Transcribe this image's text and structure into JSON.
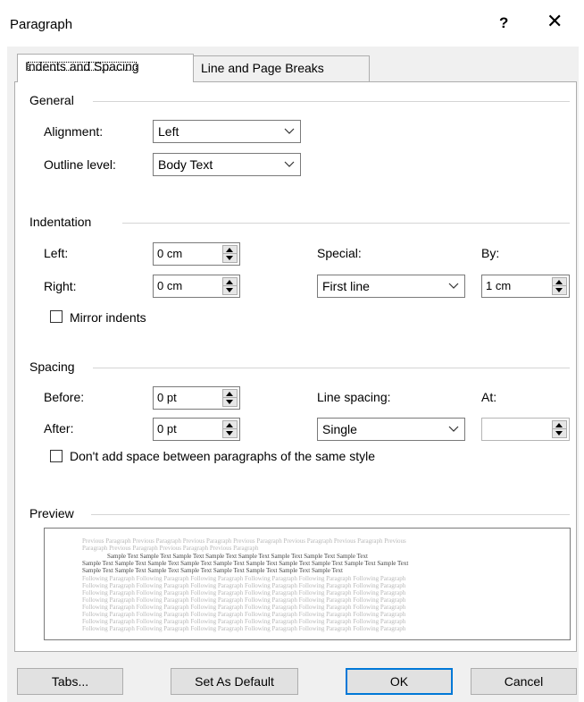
{
  "dialog": {
    "title": "Paragraph",
    "help_glyph": "?",
    "close_glyph": "✕"
  },
  "tabs": [
    {
      "label": "Indents and Spacing",
      "active": true
    },
    {
      "label": "Line and Page Breaks",
      "active": false
    }
  ],
  "general": {
    "heading": "General",
    "alignment_label": "Alignment:",
    "alignment_value": "Left",
    "outline_label": "Outline level:",
    "outline_value": "Body Text"
  },
  "indentation": {
    "heading": "Indentation",
    "left_label": "Left:",
    "left_value": "0 cm",
    "right_label": "Right:",
    "right_value": "0 cm",
    "special_label": "Special:",
    "special_value": "First line",
    "by_label": "By:",
    "by_value": "1 cm",
    "mirror_label": "Mirror indents",
    "mirror_checked": false
  },
  "spacing": {
    "heading": "Spacing",
    "before_label": "Before:",
    "before_value": "0 pt",
    "after_label": "After:",
    "after_value": "0 pt",
    "line_spacing_label": "Line spacing:",
    "line_spacing_value": "Single",
    "at_label": "At:",
    "at_value": "",
    "dont_add_label": "Don't add space between paragraphs of the same style",
    "dont_add_checked": false
  },
  "preview": {
    "heading": "Preview",
    "previous_line": "Previous Paragraph Previous Paragraph Previous Paragraph Previous Paragraph Previous Paragraph Previous Paragraph Previous",
    "previous_line2": "Paragraph Previous Paragraph Previous Paragraph Previous Paragraph",
    "sample_line1": "Sample Text Sample Text Sample Text Sample Text Sample Text Sample Text Sample Text Sample Text",
    "sample_line2": "Sample Text Sample Text Sample Text Sample Text Sample Text Sample Text Sample Text Sample Text Sample Text Sample Text",
    "sample_line3": "Sample Text Sample Text Sample Text Sample Text Sample Text Sample Text Sample Text Sample Text",
    "following_line": "Following Paragraph Following Paragraph Following Paragraph Following Paragraph Following Paragraph Following Paragraph"
  },
  "buttons": {
    "tabs": "Tabs...",
    "set_default": "Set As Default",
    "ok": "OK",
    "cancel": "Cancel"
  },
  "colors": {
    "accent": "#0078d7",
    "panel_bg": "#f0f0f0"
  }
}
